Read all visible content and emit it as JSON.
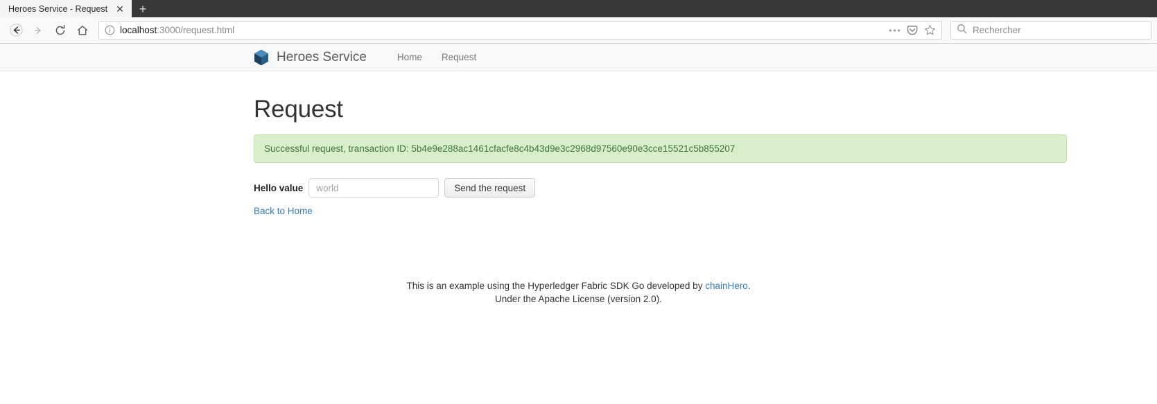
{
  "browser": {
    "tab": {
      "title": "Heroes Service - Request",
      "close_label": "✕"
    },
    "new_tab_label": "+",
    "url": {
      "host": "localhost",
      "path": ":3000/request.html"
    },
    "search": {
      "placeholder": "Rechercher"
    },
    "icons": {
      "back": "back-arrow-icon",
      "forward": "forward-arrow-icon",
      "reload": "reload-icon",
      "home": "home-icon",
      "page_info": "info-icon",
      "more": "ellipsis-icon",
      "pocket": "pocket-icon",
      "bookmark": "star-icon",
      "search": "search-icon"
    }
  },
  "site": {
    "brand": "Heroes Service",
    "brand_logo": "hexagon-cube-logo-icon",
    "nav": [
      {
        "label": "Home"
      },
      {
        "label": "Request"
      }
    ]
  },
  "page": {
    "title": "Request",
    "alert": {
      "text": "Successful request, transaction ID: 5b4e9e288ac1461cfacfe8c4b43d9e3c2968d97560e90e3cce15521c5b855207",
      "type": "success",
      "bg_color": "#d9eeca",
      "border_color": "#c4e3ad",
      "text_color": "#3c763d"
    },
    "form": {
      "label": "Hello value",
      "input_placeholder": "world",
      "input_value": "",
      "submit_label": "Send the request"
    },
    "back_link": "Back to Home"
  },
  "footer": {
    "line1_prefix": "This is an example using the Hyperledger Fabric SDK Go developed by ",
    "line1_link": "chainHero",
    "line1_suffix": ".",
    "line2": "Under the Apache License (version 2.0)."
  }
}
